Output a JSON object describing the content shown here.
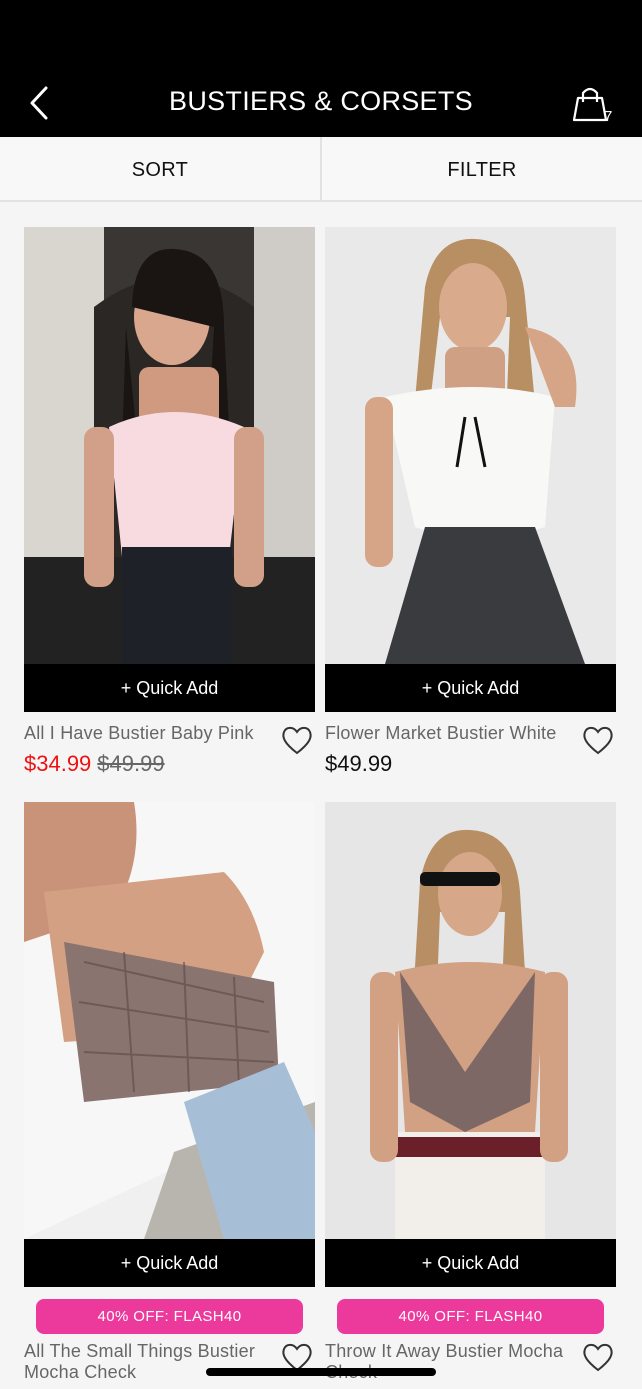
{
  "header": {
    "title": "BUSTIERS & CORSETS",
    "cart_count": "7"
  },
  "toolbar": {
    "sort_label": "SORT",
    "filter_label": "FILTER"
  },
  "products": [
    {
      "name": "All I Have Bustier Baby Pink",
      "sale_price": "$34.99",
      "original_price": "$49.99",
      "quick_add": "+ Quick Add"
    },
    {
      "name": "Flower Market Bustier White",
      "price": "$49.99",
      "quick_add": "+ Quick Add"
    },
    {
      "name": "All The Small Things Bustier Mocha Check",
      "promo": "40% OFF: FLASH40",
      "quick_add": "+ Quick Add"
    },
    {
      "name": "Throw It Away Bustier Mocha Check",
      "promo": "40% OFF: FLASH40",
      "quick_add": "+ Quick Add"
    }
  ],
  "colors": {
    "header_bg": "#000000",
    "sale_red": "#e11111",
    "promo_pink": "#ec3a9c"
  }
}
